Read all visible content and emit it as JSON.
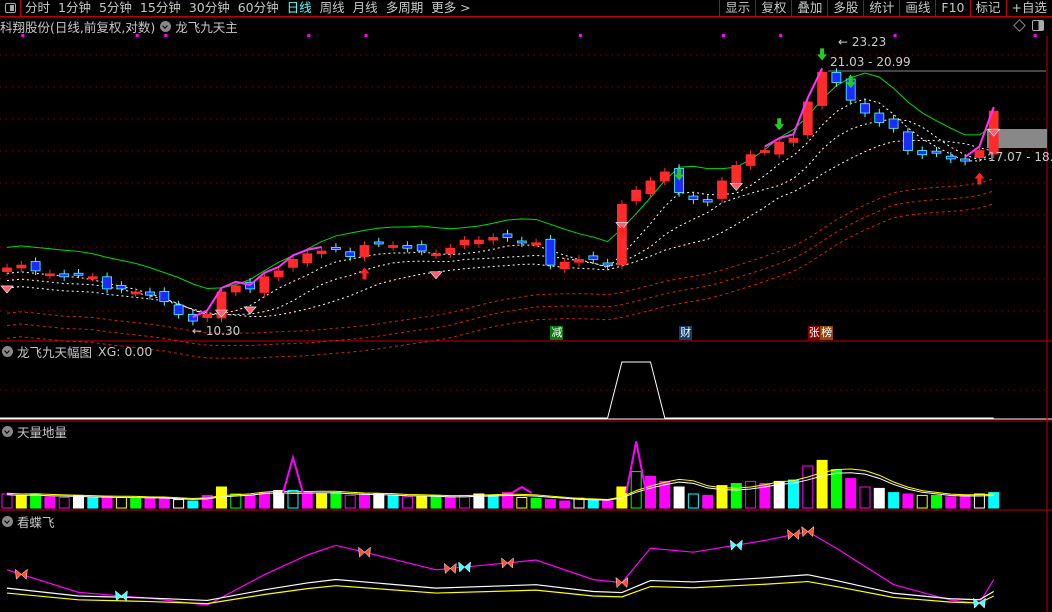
{
  "toolbar": {
    "periods": [
      "分时",
      "1分钟",
      "5分钟",
      "15分钟",
      "30分钟",
      "60分钟",
      "日线",
      "周线",
      "月线",
      "多周期",
      "更多 >"
    ],
    "active_period": "日线",
    "right_buttons": [
      "显示",
      "复权",
      "叠加",
      "多股",
      "统计",
      "画线",
      "F10",
      "标记",
      "+自选"
    ]
  },
  "main_panel": {
    "stock_title": "科翔股份(日线,前复权,对数)",
    "indicator": "龙飞九天主",
    "high_label": "23.23",
    "range_label_1": "21.03 - 20.99",
    "low_label": "10.30",
    "range_label_2": "17.07 - 18.",
    "tags": [
      {
        "text": "减",
        "color": "#0a7a0a",
        "index": 38
      },
      {
        "text": "财",
        "color": "#12406e",
        "index": 47
      },
      {
        "text": "张",
        "color": "#8a0000",
        "index": 56
      },
      {
        "text": "榜",
        "color": "#8a4a10",
        "index": 57
      }
    ]
  },
  "panel2": {
    "title": "龙飞九天幅图",
    "value_label": "XG: 0.00"
  },
  "panel3": {
    "title": "天量地量"
  },
  "panel4": {
    "title": "看蝶飞"
  },
  "colors": {
    "up": "#ff2a2a",
    "down_fill": "#1a2cff",
    "down_edge": "#54ffff",
    "grid": "#a00000",
    "ma_green": "#00dd00",
    "trend": "#ff33ff"
  },
  "chart_data": {
    "type": "candlestick",
    "price_scale": "log",
    "price_range": [
      10.3,
      23.23
    ],
    "closes": [
      12.2,
      12.3,
      12.1,
      12.0,
      11.9,
      12.0,
      11.9,
      11.5,
      11.5,
      11.4,
      11.3,
      11.1,
      10.7,
      10.5,
      10.7,
      11.4,
      11.6,
      11.5,
      11.9,
      12.1,
      12.5,
      12.7,
      12.8,
      12.9,
      12.6,
      13.0,
      13.1,
      13.0,
      12.9,
      12.8,
      12.7,
      12.9,
      13.2,
      13.2,
      13.3,
      13.3,
      13.1,
      13.1,
      12.3,
      12.4,
      12.5,
      12.5,
      12.3,
      14.6,
      15.2,
      15.6,
      16.0,
      15.1,
      14.8,
      14.7,
      15.6,
      16.3,
      16.8,
      17.0,
      17.4,
      17.6,
      19.5,
      21.2,
      20.6,
      19.6,
      18.9,
      18.4,
      18.1,
      17.0,
      16.8,
      16.9,
      16.6,
      16.5,
      17.0,
      19.0
    ],
    "volumes": [
      20,
      18,
      20,
      16,
      15,
      18,
      15,
      17,
      15,
      14,
      15,
      14,
      12,
      10,
      18,
      30,
      20,
      18,
      22,
      25,
      25,
      22,
      20,
      22,
      18,
      20,
      20,
      18,
      16,
      16,
      18,
      16,
      18,
      20,
      18,
      22,
      15,
      14,
      12,
      10,
      14,
      12,
      10,
      30,
      52,
      45,
      38,
      30,
      20,
      18,
      32,
      35,
      38,
      35,
      38,
      40,
      60,
      68,
      55,
      42,
      30,
      28,
      22,
      20,
      18,
      18,
      16,
      18,
      20,
      22
    ],
    "volume_spikes": [
      {
        "index": 20,
        "value": 72
      },
      {
        "index": 36,
        "value": 30
      },
      {
        "index": 44,
        "value": 95
      }
    ],
    "fan_signal": {
      "indices": [
        43,
        44,
        45
      ],
      "value": 1
    },
    "butterfly_line": {
      "indices": [
        0,
        5,
        10,
        14,
        18,
        21,
        23,
        25,
        30,
        35,
        37,
        41,
        43,
        45,
        48,
        53,
        56,
        58,
        62,
        66,
        68,
        69
      ],
      "values": [
        41,
        18,
        12,
        5,
        36,
        56,
        66,
        59,
        41,
        48,
        51,
        31,
        28,
        63,
        59,
        71,
        80,
        63,
        26,
        10,
        7,
        31
      ]
    },
    "butterfly_marks": [
      1,
      8,
      25,
      31,
      32,
      35,
      43,
      51,
      55,
      56,
      68
    ],
    "gem_marks": [
      0,
      15,
      17,
      30,
      43,
      51,
      69
    ],
    "up_arrows": [
      25,
      43,
      68
    ],
    "down_arrows": [
      47,
      54,
      57,
      59
    ]
  }
}
